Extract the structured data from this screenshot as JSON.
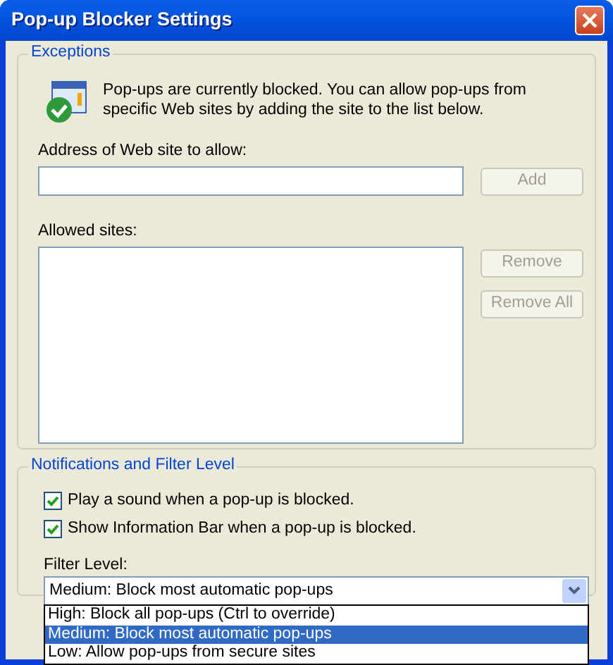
{
  "window": {
    "title": "Pop-up Blocker Settings"
  },
  "exceptions": {
    "title": "Exceptions",
    "message": "Pop-ups are currently blocked.  You can allow pop-ups from specific Web sites by adding the site to the list below.",
    "address_label": "Address of Web site to allow:",
    "add_button": {
      "label": "Add",
      "disabled": true
    },
    "allowed_label": "Allowed sites:",
    "list_buttons": [
      {
        "label": "Remove",
        "disabled": true
      },
      {
        "label": "Remove All",
        "disabled": true
      }
    ]
  },
  "notifications": {
    "title": "Notifications and Filter Level",
    "options": [
      {
        "label": "Play a sound when a pop-up is blocked.",
        "checked": true
      },
      {
        "label": "Show Information Bar when a pop-up is blocked.",
        "checked": true
      }
    ],
    "filter_label": "Filter Level:",
    "filter": {
      "value": "Medium: Block most automatic pop-ups",
      "expanded": true,
      "options": [
        {
          "label": "High: Block all pop-ups (Ctrl to override)",
          "selected": false
        },
        {
          "label": "Medium: Block most automatic pop-ups",
          "selected": true
        },
        {
          "label": "Low: Allow pop-ups from secure sites",
          "selected": false
        }
      ]
    }
  }
}
